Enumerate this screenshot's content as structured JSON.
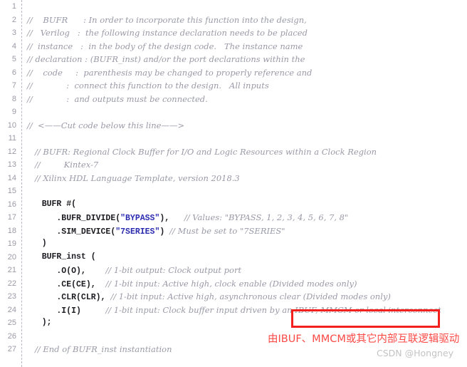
{
  "editor": {
    "language": "verilog",
    "gutter_start": 1,
    "lines": [
      {
        "no": "1",
        "segments": []
      },
      {
        "no": "2",
        "segments": [
          {
            "t": "cmt",
            "s": "//    BUFR      : In order to incorporate this function into the design,"
          }
        ]
      },
      {
        "no": "3",
        "segments": [
          {
            "t": "cmt",
            "s": "//   Verilog   :  the following instance declaration needs to be placed"
          }
        ]
      },
      {
        "no": "4",
        "segments": [
          {
            "t": "cmt",
            "s": "//  instance   :  in the body of the design code.   The instance name"
          }
        ]
      },
      {
        "no": "5",
        "segments": [
          {
            "t": "cmt",
            "s": "// declaration : (BUFR_inst) and/or the port declarations within the"
          }
        ]
      },
      {
        "no": "6",
        "segments": [
          {
            "t": "cmt",
            "s": "//    code     :  parenthesis may be changed to properly reference and"
          }
        ]
      },
      {
        "no": "7",
        "segments": [
          {
            "t": "cmt",
            "s": "//             :  connect this function to the design.   All inputs"
          }
        ]
      },
      {
        "no": "8",
        "segments": [
          {
            "t": "cmt",
            "s": "//             :  and outputs must be connected."
          }
        ]
      },
      {
        "no": "9",
        "segments": []
      },
      {
        "no": "10",
        "segments": [
          {
            "t": "cmt",
            "s": "//  <——Cut code below this line——>"
          }
        ]
      },
      {
        "no": "11",
        "segments": []
      },
      {
        "no": "12",
        "segments": [
          {
            "t": "cmt",
            "s": "   // BUFR: Regional Clock Buffer for I/O and Logic Resources within a Clock Region"
          }
        ]
      },
      {
        "no": "13",
        "segments": [
          {
            "t": "cmt",
            "s": "   //         Kintex-7"
          }
        ]
      },
      {
        "no": "14",
        "segments": [
          {
            "t": "cmt",
            "s": "   // Xilinx HDL Language Template, version 2018.3"
          }
        ]
      },
      {
        "no": "15",
        "segments": []
      },
      {
        "no": "16",
        "segments": [
          {
            "t": "code",
            "s": "   BUFR #("
          }
        ]
      },
      {
        "no": "17",
        "segments": [
          {
            "t": "code",
            "s": "      .BUFR_DIVIDE("
          },
          {
            "t": "str",
            "s": "\"BYPASS\""
          },
          {
            "t": "code",
            "s": "),   "
          },
          {
            "t": "cmt",
            "s": "// Values: \"BYPASS, 1, 2, 3, 4, 5, 6, 7, 8\""
          }
        ]
      },
      {
        "no": "18",
        "segments": [
          {
            "t": "code",
            "s": "      .SIM_DEVICE("
          },
          {
            "t": "str",
            "s": "\"7SERIES\""
          },
          {
            "t": "code",
            "s": ") "
          },
          {
            "t": "cmt",
            "s": "// Must be set to \"7SERIES\""
          }
        ]
      },
      {
        "no": "19",
        "segments": [
          {
            "t": "code",
            "s": "   )"
          }
        ]
      },
      {
        "no": "20",
        "segments": [
          {
            "t": "code",
            "s": "   BUFR_inst ("
          }
        ]
      },
      {
        "no": "21",
        "segments": [
          {
            "t": "code",
            "s": "      .O(O),    "
          },
          {
            "t": "cmt",
            "s": "// 1-bit output: Clock output port"
          }
        ]
      },
      {
        "no": "22",
        "segments": [
          {
            "t": "code",
            "s": "      .CE(CE),  "
          },
          {
            "t": "cmt",
            "s": "// 1-bit input: Active high, clock enable (Divided modes only)"
          }
        ]
      },
      {
        "no": "23",
        "segments": [
          {
            "t": "code",
            "s": "      .CLR(CLR), "
          },
          {
            "t": "cmt",
            "s": "// 1-bit input: Active high, asynchronous clear (Divided modes only)"
          }
        ]
      },
      {
        "no": "24",
        "segments": [
          {
            "t": "code",
            "s": "      .I(I)     "
          },
          {
            "t": "cmt",
            "s": "// 1-bit input: Clock buffer input driven by an IBUF, MMCM or local interconnect"
          }
        ]
      },
      {
        "no": "25",
        "segments": [
          {
            "t": "code",
            "s": "   );"
          }
        ]
      },
      {
        "no": "26",
        "segments": []
      },
      {
        "no": "27",
        "segments": [
          {
            "t": "cmt",
            "s": "   // End of BUFR_inst instantiation"
          }
        ]
      }
    ]
  },
  "annotations": {
    "highlight_box": {
      "label": "IBUF, MMCM or local interconnect",
      "color": "#f4201d"
    },
    "note": {
      "text": "由IBUF、MMCM或其它内部互联逻辑驱动",
      "color": "#fb4a46"
    }
  },
  "watermark": {
    "text": "CSDN @Hongney",
    "color": "#c3c3c3"
  }
}
